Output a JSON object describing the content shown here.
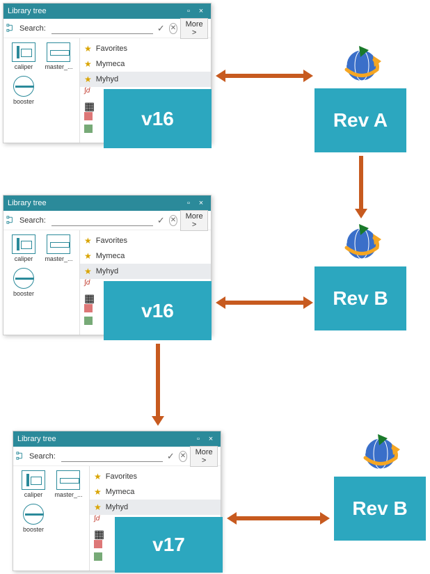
{
  "panel": {
    "title": "Library tree",
    "search_label": "Search:",
    "more_label": "More >",
    "favorites": [
      "Favorites",
      "Mymeca",
      "Myhyd"
    ],
    "components": [
      "caliper",
      "master_...",
      "booster"
    ]
  },
  "version_labels": {
    "panel1": "v16",
    "panel2": "v16",
    "panel3": "v17"
  },
  "rev_labels": {
    "rev1": "Rev A",
    "rev2": "Rev B",
    "rev3": "Rev B"
  },
  "colors": {
    "teal_header": "#2b8a9a",
    "teal_block": "#2ca7bf",
    "arrow": "#c75a1f"
  }
}
